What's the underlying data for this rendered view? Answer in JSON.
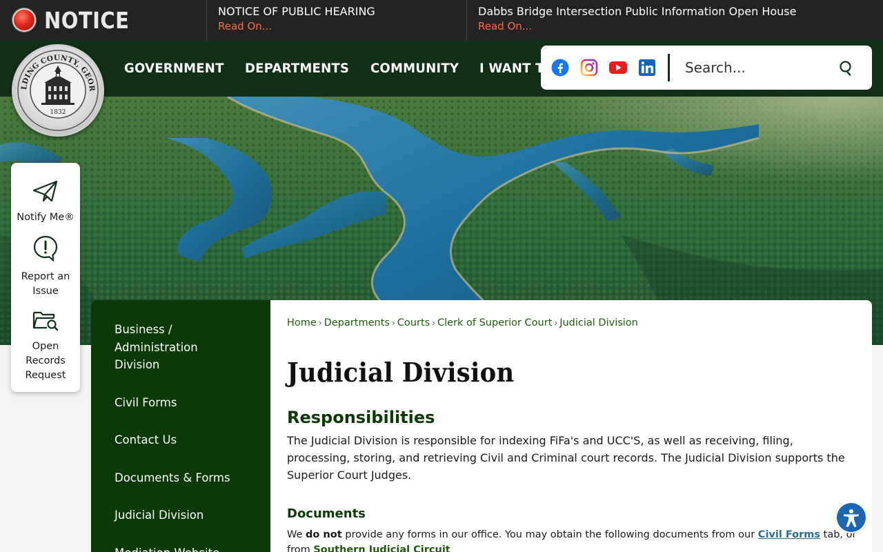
{
  "notice": {
    "title": "NOTICE",
    "items": [
      {
        "title": "NOTICE OF PUBLIC HEARING",
        "link": "Read On..."
      },
      {
        "title": "Dabbs Bridge Intersection Public Information Open House",
        "link": "Read On..."
      }
    ]
  },
  "logo": {
    "text": "PAULDING COUNTY, GEORGIA",
    "year": "1832"
  },
  "nav": [
    "GOVERNMENT",
    "DEPARTMENTS",
    "COMMUNITY",
    "I WANT TO..."
  ],
  "search": {
    "placeholder": "Search..."
  },
  "quick_links": [
    {
      "label": "Notify Me®",
      "icon": "paper-plane-icon"
    },
    {
      "label": "Report an Issue",
      "icon": "alert-icon"
    },
    {
      "label": "Open Records Request",
      "icon": "folder-search-icon"
    }
  ],
  "sidenav": [
    "Business / Administration Division",
    "Civil Forms",
    "Contact Us",
    "Documents & Forms",
    "Judicial Division",
    "Mediation Website"
  ],
  "breadcrumb": [
    "Home",
    "Departments",
    "Courts",
    "Clerk of Superior Court",
    "Judicial Division"
  ],
  "page": {
    "title": "Judicial Division",
    "section1_title": "Responsibilities",
    "section1_text": "The Judicial Division is responsible for indexing FiFa's and UCC'S, as well as receiving, filing, processing, storing, and retrieving Civil and Criminal court records. The Judicial Division supports the Superior Court Judges.",
    "section2_title": "Documents",
    "section2_text": {
      "a": "We ",
      "b": "do not",
      "c": " provide any forms in our office. You may obtain the following documents from our ",
      "link1": "Civil Forms",
      "d": " tab, or from ",
      "link2": "Southern Judicial Circuit"
    }
  },
  "colors": {
    "header_green": "#123017",
    "sidenav_green": "#0c3a06",
    "notice_bg": "#232323",
    "read_on": "#ff6b47",
    "link_green": "#1f5a0e"
  }
}
